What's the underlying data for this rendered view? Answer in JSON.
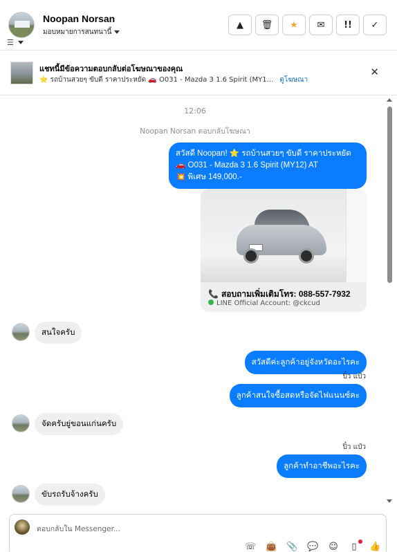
{
  "header": {
    "contact_name": "Noopan Norsan",
    "assign_label": "มอบหมายการสนทนานี้",
    "toolbar_icons": [
      "warning-icon",
      "trash-icon",
      "star-icon",
      "mail-open-icon",
      "alert-icon",
      "check-icon"
    ]
  },
  "ad_banner": {
    "title": "แชทนี้มีข้อความตอบกลับต่อโฆษณาของคุณ",
    "subtitle": "⭐ รถบ้านสวยๆ ขับดี ราคาประหยัด 🚗 O031 - Mazda 3 1.6 Spirit (MY1...",
    "link": "ดูโฆษณา"
  },
  "chat": {
    "timestamp": "12:06",
    "system_note": "Noopan Norsan ตอบกลับโฆษณา",
    "first_message": {
      "line1": "สวัสดี Noopan! ⭐ รถบ้านสวยๆ ขับดี ราคาประหยัด",
      "line2": "🚗 O031 - Mazda 3 1.6 Spirit (MY12) AT",
      "line3": "💥 พิเศษ 149,000.-"
    },
    "card": {
      "phone_line": "สอบถามเพิ่มเติมโทร: 088-557-7932",
      "line_account": "LINE Official Account: @ckcud"
    },
    "messages": [
      {
        "side": "in",
        "text": "สนใจครับ"
      },
      {
        "side": "out",
        "text": "สวัสดีค่ะลูกค้าอยู่จังหวัดอะไรคะ"
      },
      {
        "side": "out",
        "text": "ลูกค้าสนใจซื้อสดหรือจัดไฟแนนซ์คะ"
      },
      {
        "side": "in",
        "text": "จัดครับยู่ขอนแก่นครับ"
      },
      {
        "side": "out",
        "text": "ลูกค้าทำอาชีพอะไรคะ"
      },
      {
        "side": "in",
        "text": "ขับรถรับจ้างครับ"
      }
    ],
    "seen_by": "ปิ๋ว แป๋ว"
  },
  "composer": {
    "placeholder": "ตอบกลับใน Messenger..."
  },
  "colors": {
    "accent": "#0a7cff",
    "incoming_bubble": "#efeff1",
    "star": "#f7a63a"
  }
}
